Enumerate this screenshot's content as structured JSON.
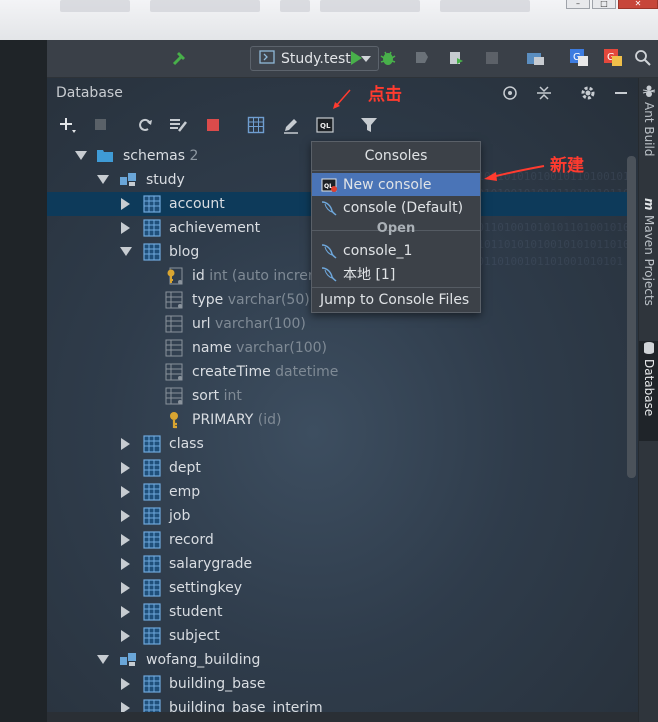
{
  "toolbar": {
    "run_config": "Study.test"
  },
  "window": {
    "minimize": "–",
    "maximize": "□",
    "close": "✕"
  },
  "panel": {
    "title": "Database"
  },
  "tree": {
    "schemas": {
      "label": "schemas",
      "count": "2"
    },
    "study": {
      "label": "study"
    },
    "tables_before": [
      {
        "label": "account"
      },
      {
        "label": "achievement"
      }
    ],
    "blog": {
      "label": "blog"
    },
    "columns": [
      {
        "name": "id",
        "type": "int (auto increr"
      },
      {
        "name": "type",
        "type": "varchar(50)"
      },
      {
        "name": "url",
        "type": "varchar(100)"
      },
      {
        "name": "name",
        "type": "varchar(100)"
      },
      {
        "name": "createTime",
        "type": "datetime"
      },
      {
        "name": "sort",
        "type": "int"
      }
    ],
    "primary": {
      "name": "PRIMARY",
      "type": "(id)"
    },
    "tables_after": [
      {
        "label": "class"
      },
      {
        "label": "dept"
      },
      {
        "label": "emp"
      },
      {
        "label": "job"
      },
      {
        "label": "record"
      },
      {
        "label": "salarygrade"
      },
      {
        "label": "settingkey"
      },
      {
        "label": "student"
      },
      {
        "label": "subject"
      }
    ],
    "wofang": {
      "label": "wofang_building"
    },
    "wofang_tables": [
      {
        "label": "building_base"
      },
      {
        "label": "building_base_interim"
      }
    ]
  },
  "popup": {
    "title": "Consoles",
    "new_console": "New console",
    "default_console": "console (Default)",
    "open_header": "Open",
    "console_1": "console_1",
    "local": "本地 [1]",
    "jump": "Jump to Console Files"
  },
  "sidebar": {
    "ant": "Ant Build",
    "maven": "Maven Projects",
    "database": "Database"
  },
  "annotations": {
    "click": "点击",
    "new": "新建"
  },
  "colors": {
    "accent_green": "#48b04a",
    "highlight": "#4a74b7",
    "selection": "#0d3a5a",
    "annotation_red": "#ff3b2f"
  }
}
